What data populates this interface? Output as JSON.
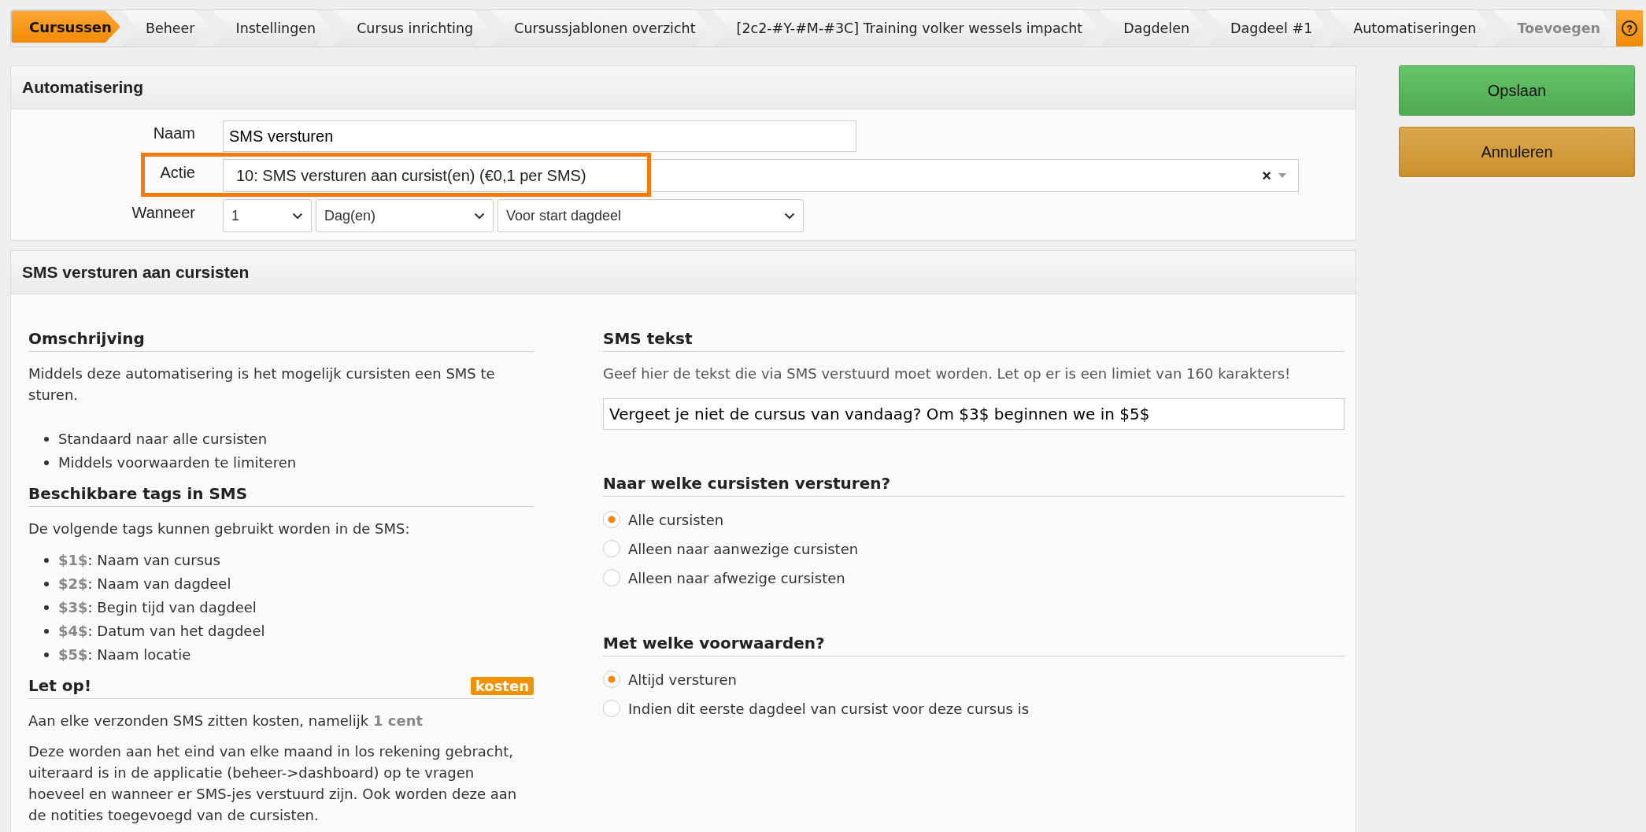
{
  "breadcrumb": {
    "items": [
      {
        "label": "Cursussen",
        "selected": true,
        "disabled": false
      },
      {
        "label": "Beheer",
        "selected": false,
        "disabled": false
      },
      {
        "label": "Instellingen",
        "selected": false,
        "disabled": false
      },
      {
        "label": "Cursus inrichting",
        "selected": false,
        "disabled": false
      },
      {
        "label": "Cursussjablonen overzicht",
        "selected": false,
        "disabled": false
      },
      {
        "label": "[2c2-#Y-#M-#3C] Training volker wessels impacht",
        "selected": false,
        "disabled": false
      },
      {
        "label": "Dagdelen",
        "selected": false,
        "disabled": false
      },
      {
        "label": "Dagdeel #1",
        "selected": false,
        "disabled": false
      },
      {
        "label": "Automatiseringen",
        "selected": false,
        "disabled": false
      },
      {
        "label": "Toevoegen",
        "selected": false,
        "disabled": true
      }
    ],
    "help_icon": "?"
  },
  "automation_panel": {
    "title": "Automatisering",
    "fields": [
      {
        "kind": "text",
        "label": "Naam",
        "value": "SMS versturen"
      },
      {
        "kind": "select",
        "label": "Actie",
        "value": "10: SMS versturen aan cursist(en) (€0,1 per SMS)",
        "clear_icon": "×",
        "highlighted": true
      },
      {
        "kind": "selects",
        "label": "Wanneer",
        "values": [
          "1",
          "Dag(en)",
          "Voor start dagdeel"
        ]
      }
    ]
  },
  "sms_panel": {
    "title": "SMS versturen aan cursisten",
    "description": {
      "title": "Omschrijving",
      "text": "Middels deze automatisering is het mogelijk cursisten een SMS te sturen.",
      "bullets": [
        "Standaard naar alle cursisten",
        "Middels voorwaarden te limiteren"
      ]
    },
    "tags": {
      "title": "Beschikbare tags in SMS",
      "intro": "De volgende tags kunnen gebruikt worden in de SMS:",
      "items": [
        {
          "tag": "$1$",
          "text": ": Naam van cursus"
        },
        {
          "tag": "$2$",
          "text": ": Naam van dagdeel"
        },
        {
          "tag": "$3$",
          "text": ": Begin tijd van dagdeel"
        },
        {
          "tag": "$4$",
          "text": ": Datum van het dagdeel"
        },
        {
          "tag": "$5$",
          "text": ": Naam locatie"
        }
      ]
    },
    "notice": {
      "title": "Let op!",
      "badge": "kosten",
      "text": "Aan elke verzonden SMS zitten kosten, namelijk ",
      "emphasis": "1 cent",
      "paragraph": "Deze worden aan het eind van elke maand in los rekening gebracht, uiteraard is in de applicatie (beheer->dashboard) op te vragen hoeveel en wanneer er SMS-jes verstuurd zijn. Ook worden deze aan de notities toegevoegd van de cursisten."
    },
    "sms_text": {
      "title": "SMS tekst",
      "hint": "Geef hier de tekst die via SMS verstuurd moet worden. Let op er is een limiet van 160 karakters!",
      "value": "Vergeet je niet de cursus van vandaag? Om $3$ beginnen we in $5$"
    },
    "radio_groups": [
      {
        "title": "Naar welke cursisten versturen?",
        "options": [
          {
            "label": "Alle cursisten",
            "selected": true
          },
          {
            "label": "Alleen naar aanwezige cursisten",
            "selected": false
          },
          {
            "label": "Alleen naar afwezige cursisten",
            "selected": false
          }
        ]
      },
      {
        "title": "Met welke voorwaarden?",
        "options": [
          {
            "label": "Altijd versturen",
            "selected": true
          },
          {
            "label": "Indien dit eerste dagdeel van cursist voor deze cursus is",
            "selected": false
          }
        ]
      }
    ]
  },
  "actions": [
    {
      "kind": "save",
      "label": "Opslaan"
    },
    {
      "kind": "cancel",
      "label": "Annuleren"
    }
  ]
}
